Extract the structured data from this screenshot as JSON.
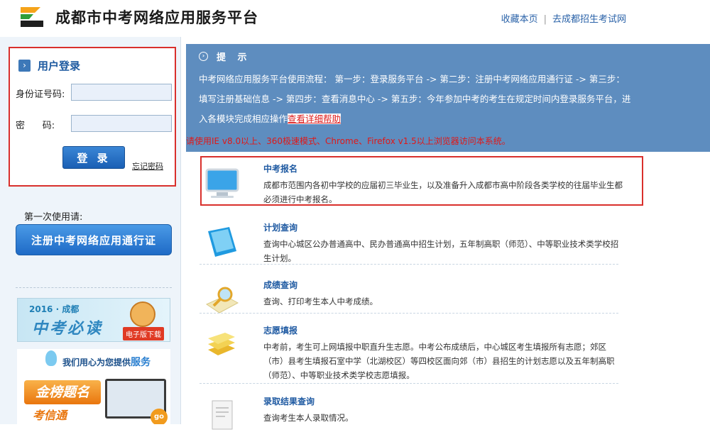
{
  "header": {
    "title": "成都市中考网络应用服务平台",
    "links": [
      "收藏本页",
      "去成都招生考试网"
    ],
    "separator": "|"
  },
  "login": {
    "title": "用户登录",
    "id_label": "身份证号码:",
    "pwd_label": "密      码:",
    "id_value": "",
    "pwd_value": "",
    "submit_label": "登 录",
    "forgot_label": "忘记密码"
  },
  "first_use": {
    "label": "第一次使用请:",
    "register_label": "注册中考网络应用通行证"
  },
  "banners": {
    "b1_year": "2016 · 成都",
    "b1_main": "中考必读",
    "b1_tag": "电子版下载",
    "b2_slogan_pre": "我们用心为您提供",
    "b2_slogan_hl": "服务",
    "b2_gold": "金榜题名",
    "b2_sub": "考信通",
    "b2_go": "go"
  },
  "notice": {
    "heading": "提 示",
    "body": "中考网络应用服务平台使用流程： 第一步：登录服务平台 -> 第二步：注册中考网络应用通行证 -> 第三步：填写注册基础信息 -> 第四步：查看消息中心 -> 第五步：今年参加中考的考生在规定时间内登录服务平台，进入各模块完成相应操作",
    "link": "查看详细帮助",
    "warning": "请使用IE v8.0以上、360极速模式、Chrome、Firefox v1.5以上浏览器访问本系统。"
  },
  "services": [
    {
      "title": "中考报名",
      "desc": "成都市范围内各初中学校的应届初三毕业生，以及准备升入成都市高中阶段各类学校的往届毕业生都必须进行中考报名。",
      "icon": "monitor-icon"
    },
    {
      "title": "计划查询",
      "desc": "查询中心城区公办普通高中、民办普通高中招生计划，五年制高职（师范）、中等职业技术类学校招生计划。",
      "icon": "notebook-icon"
    },
    {
      "title": "成绩查询",
      "desc": "查询、打印考生本人中考成绩。",
      "icon": "magnifier-icon"
    },
    {
      "title": "志愿填报",
      "desc": "中考前，考生可上网填报中职直升生志愿。中考公布成绩后，中心城区考生填报所有志愿；郊区（市）县考生填报石室中学（北湖校区）等四校区面向郊（市）县招生的计划志愿以及五年制高职（师范）、中等职业技术类学校志愿填报。",
      "icon": "books-icon"
    },
    {
      "title": "录取结果查询",
      "desc": "查询考生本人录取情况。",
      "icon": "document-icon"
    }
  ],
  "colors": {
    "accent": "#1f5aa2",
    "notice_bg": "#5e8dbf",
    "highlight": "#d9302c",
    "warning": "#e01818"
  }
}
